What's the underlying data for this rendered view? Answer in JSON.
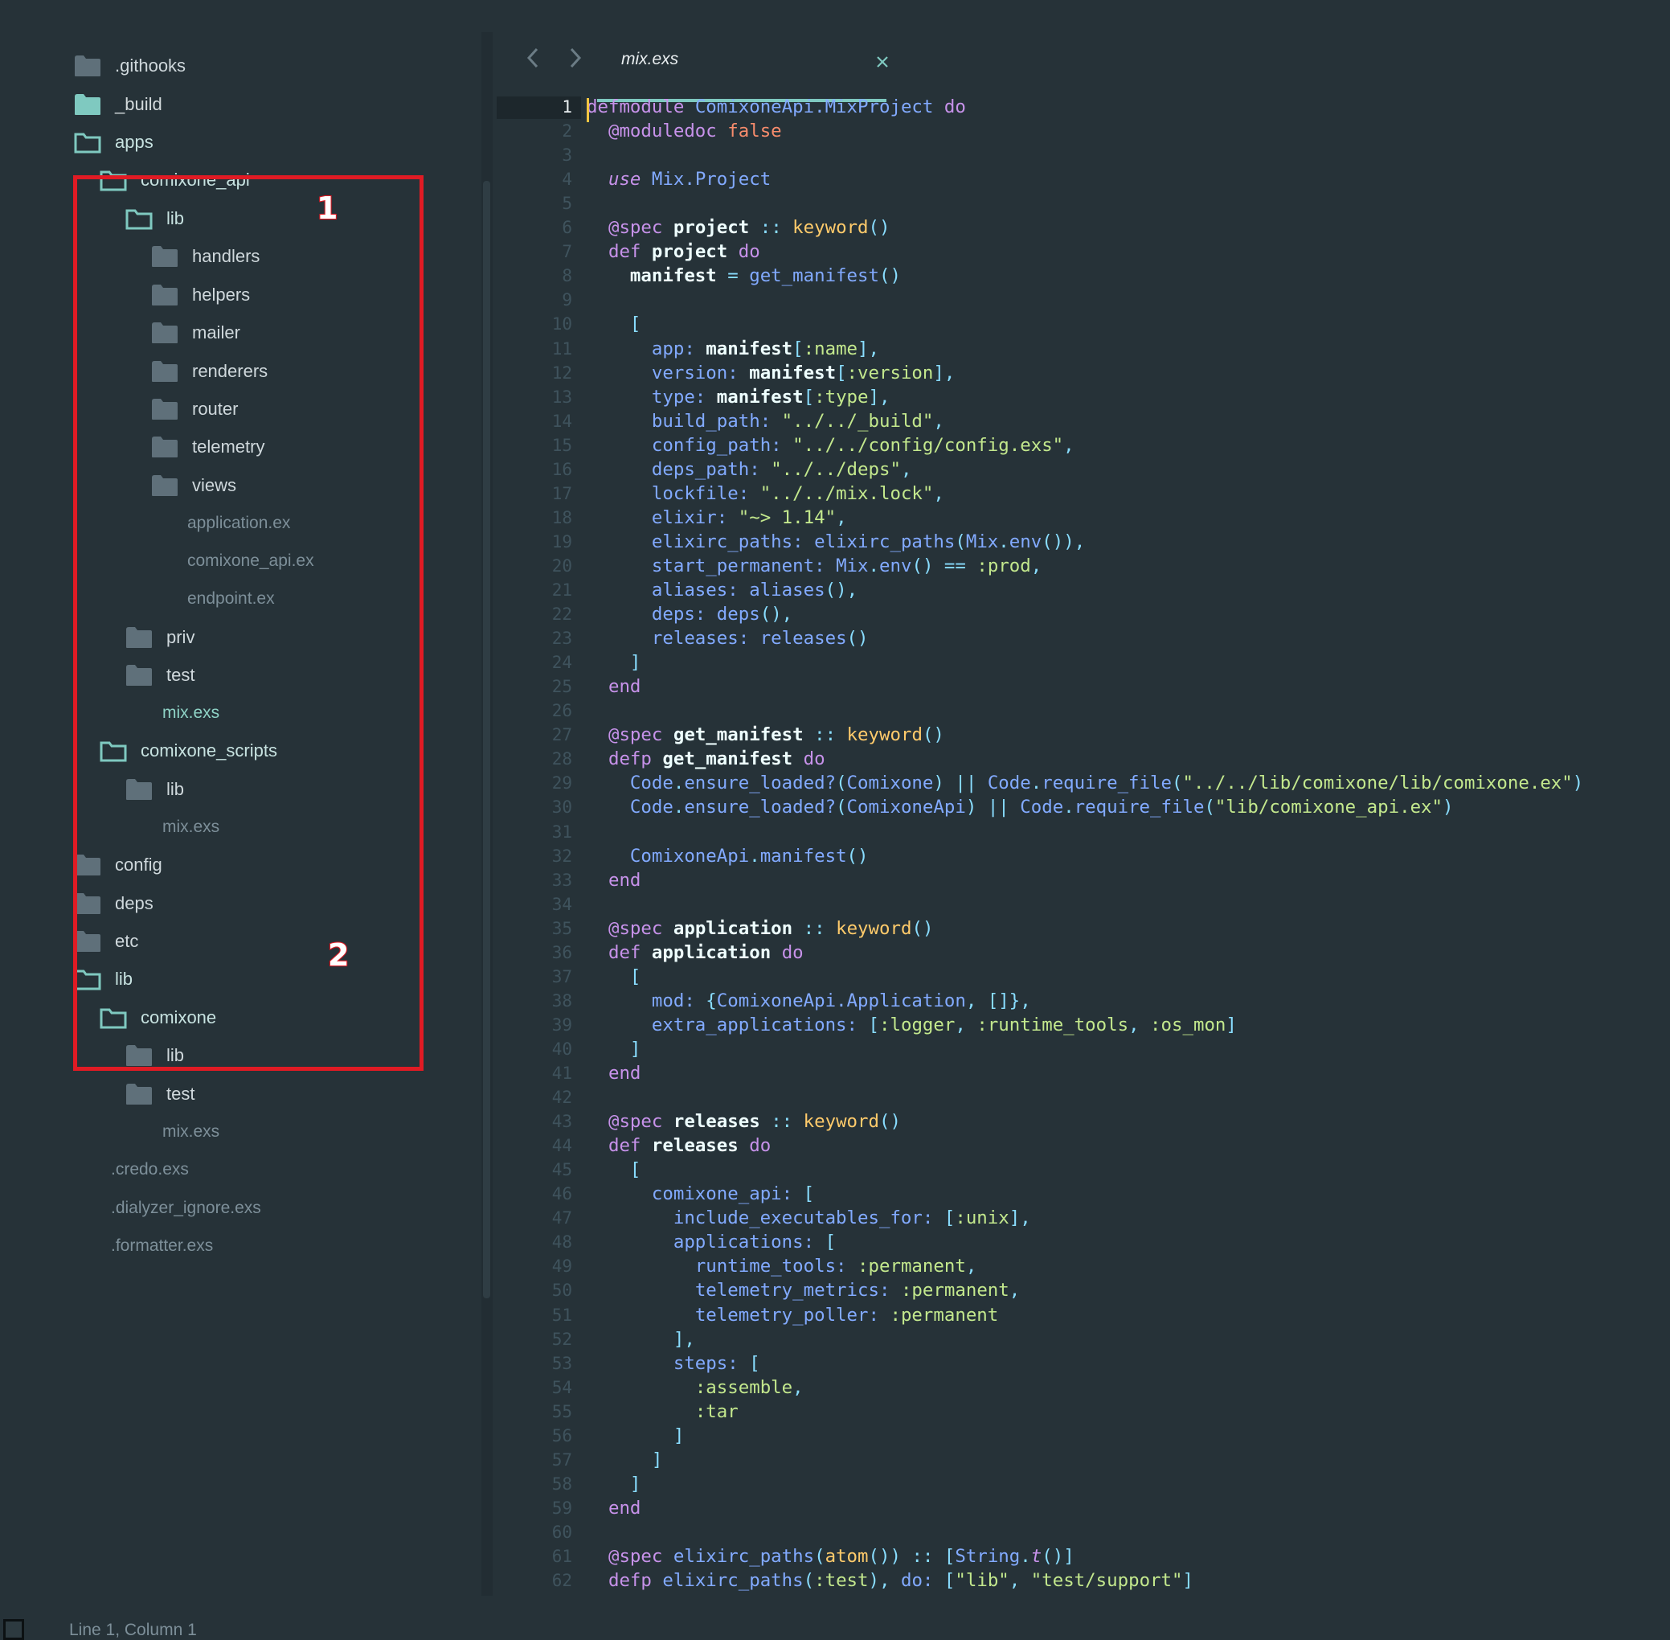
{
  "sidebar": {
    "items": [
      {
        "label": ".githooks",
        "kind": "folder",
        "open": false
      },
      {
        "label": "_build",
        "kind": "folder",
        "open": false
      },
      {
        "label": "apps",
        "kind": "folder",
        "open": true
      },
      {
        "label": "comixone_api",
        "kind": "folder",
        "open": true
      },
      {
        "label": "lib",
        "kind": "folder",
        "open": true
      },
      {
        "label": "handlers",
        "kind": "folder",
        "open": false
      },
      {
        "label": "helpers",
        "kind": "folder",
        "open": false
      },
      {
        "label": "mailer",
        "kind": "folder",
        "open": false
      },
      {
        "label": "renderers",
        "kind": "folder",
        "open": false
      },
      {
        "label": "router",
        "kind": "folder",
        "open": false
      },
      {
        "label": "telemetry",
        "kind": "folder",
        "open": false
      },
      {
        "label": "views",
        "kind": "folder",
        "open": false
      },
      {
        "label": "application.ex",
        "kind": "file"
      },
      {
        "label": "comixone_api.ex",
        "kind": "file"
      },
      {
        "label": "endpoint.ex",
        "kind": "file"
      },
      {
        "label": "priv",
        "kind": "folder",
        "open": false
      },
      {
        "label": "test",
        "kind": "folder",
        "open": false
      },
      {
        "label": "mix.exs",
        "kind": "file",
        "active": true
      },
      {
        "label": "comixone_scripts",
        "kind": "folder",
        "open": true
      },
      {
        "label": "lib",
        "kind": "folder",
        "open": false
      },
      {
        "label": "mix.exs",
        "kind": "file"
      },
      {
        "label": "config",
        "kind": "folder",
        "open": false
      },
      {
        "label": "deps",
        "kind": "folder",
        "open": false
      },
      {
        "label": "etc",
        "kind": "folder",
        "open": false
      },
      {
        "label": "lib",
        "kind": "folder",
        "open": true
      },
      {
        "label": "comixone",
        "kind": "folder",
        "open": true
      },
      {
        "label": "lib",
        "kind": "folder",
        "open": false
      },
      {
        "label": "test",
        "kind": "folder",
        "open": false
      },
      {
        "label": "mix.exs",
        "kind": "file"
      },
      {
        "label": ".credo.exs",
        "kind": "file"
      },
      {
        "label": ".dialyzer_ignore.exs",
        "kind": "file"
      },
      {
        "label": ".formatter.exs",
        "kind": "file"
      }
    ]
  },
  "annotations": [
    "1",
    "2"
  ],
  "tab": {
    "title": "mix.exs"
  },
  "editor": {
    "active_line": "1",
    "line_numbers": [
      "1",
      "2",
      "3",
      "4",
      "5",
      "6",
      "7",
      "8",
      "9",
      "10",
      "11",
      "12",
      "13",
      "14",
      "15",
      "16",
      "17",
      "18",
      "19",
      "20",
      "21",
      "22",
      "23",
      "24",
      "25",
      "26",
      "27",
      "28",
      "29",
      "30",
      "31",
      "32",
      "33",
      "34",
      "35",
      "36",
      "37",
      "38",
      "39",
      "40",
      "41",
      "42",
      "43",
      "44",
      "45",
      "46",
      "47",
      "48",
      "49",
      "50",
      "51",
      "52",
      "53",
      "54",
      "55",
      "56",
      "57",
      "58",
      "59",
      "60",
      "61",
      "62"
    ],
    "code": [
      "defmodule ComixoneApi.MixProject do",
      "  @moduledoc false",
      "",
      "  use Mix.Project",
      "",
      "  @spec project :: keyword()",
      "  def project do",
      "    manifest = get_manifest()",
      "",
      "    [",
      "      app: manifest[:name],",
      "      version: manifest[:version],",
      "      type: manifest[:type],",
      "      build_path: \"../../_build\",",
      "      config_path: \"../../config/config.exs\",",
      "      deps_path: \"../../deps\",",
      "      lockfile: \"../../mix.lock\",",
      "      elixir: \"~> 1.14\",",
      "      elixirc_paths: elixirc_paths(Mix.env()),",
      "      start_permanent: Mix.env() == :prod,",
      "      aliases: aliases(),",
      "      deps: deps(),",
      "      releases: releases()",
      "    ]",
      "  end",
      "",
      "  @spec get_manifest :: keyword()",
      "  defp get_manifest do",
      "    Code.ensure_loaded?(Comixone) || Code.require_file(\"../../lib/comixone/lib/comixone.ex\")",
      "    Code.ensure_loaded?(ComixoneApi) || Code.require_file(\"lib/comixone_api.ex\")",
      "",
      "    ComixoneApi.manifest()",
      "  end",
      "",
      "  @spec application :: keyword()",
      "  def application do",
      "    [",
      "      mod: {ComixoneApi.Application, []},",
      "      extra_applications: [:logger, :runtime_tools, :os_mon]",
      "    ]",
      "  end",
      "",
      "  @spec releases :: keyword()",
      "  def releases do",
      "    [",
      "      comixone_api: [",
      "        include_executables_for: [:unix],",
      "        applications: [",
      "          runtime_tools: :permanent,",
      "          telemetry_metrics: :permanent,",
      "          telemetry_poller: :permanent",
      "        ],",
      "        steps: [",
      "          :assemble,",
      "          :tar",
      "        ]",
      "      ]",
      "    ]",
      "  end",
      "",
      "  @spec elixirc_paths(atom()) :: [String.t()]",
      "  defp elixirc_paths(:test), do: [\"lib\", \"test/support\"]"
    ]
  },
  "status": {
    "text": "Line 1, Column 1"
  },
  "colors": {
    "background": "#263238",
    "accent": "#7fc9c0",
    "annotation": "#e01b24",
    "caret": "#f4c542"
  }
}
